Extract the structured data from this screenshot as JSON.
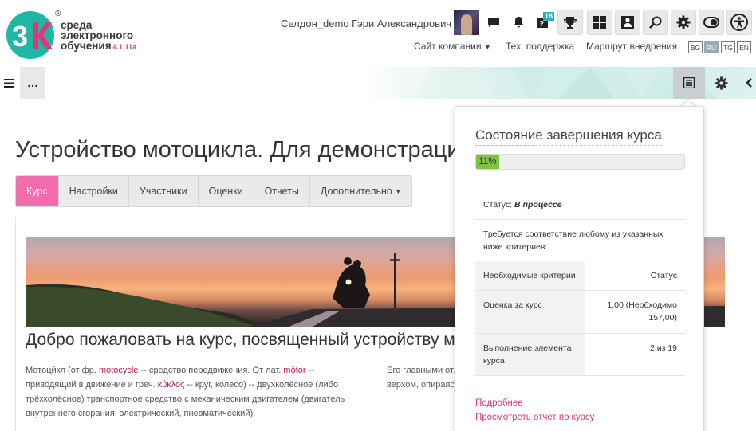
{
  "brand": {
    "line1": "среда",
    "line2": "электронного",
    "line3": "обучения",
    "version": "4.1.11a",
    "reg": "®",
    "colors": {
      "teal": "#1fb7a4",
      "pink": "#e0367a",
      "purple": "#7b3fa0"
    }
  },
  "header": {
    "user_name": "Селдон_demo Гэри Александрович",
    "notification_badge": "18",
    "icons": [
      "chat-icon",
      "bell-icon",
      "message-badge-icon",
      "trophy-icon",
      "dashboard-icon",
      "people-icon",
      "search-icon",
      "gear-icon",
      "toggle-icon",
      "accessibility-icon"
    ],
    "nav": {
      "company_site": "Сайт компании",
      "support": "Тех. поддержка",
      "route": "Маршрут внедрения"
    },
    "languages": [
      {
        "code": "BG",
        "active": false
      },
      {
        "code": "RU",
        "active": true
      },
      {
        "code": "TG",
        "active": false
      },
      {
        "code": "EN",
        "active": false
      }
    ]
  },
  "course": {
    "title": "Устройство мотоцикла. Для демонстрации",
    "tabs": [
      {
        "label": "Курс",
        "active": true
      },
      {
        "label": "Настройки",
        "active": false
      },
      {
        "label": "Участники",
        "active": false
      },
      {
        "label": "Оценки",
        "active": false
      },
      {
        "label": "Отчеты",
        "active": false
      },
      {
        "label": "Дополнительно",
        "active": false
      }
    ],
    "welcome": "Добро пожаловать на курс, посвященный устройству мотоцикла",
    "para1": {
      "p1": "Мотоци́кл (от фр. ",
      "link1": "motocycle",
      "p2": " -- средство передвижения. От лат. ",
      "link2": "mōtor",
      "p3": " -- приводящий в движение и греч. ",
      "link3": "κύκλος",
      "p4": " -- круг, колесо) -- двухколёсное (либо трёхколёсное) транспортное средство с механическим двигателем (двигатель внутреннего сгорания, электрический, пневматический)."
    },
    "para2": "Его главными отличиями являются посадка водителя (мотоциклист сидит верхом, опираясь на подножки), прямое управление передним колесом."
  },
  "completion": {
    "title": "Состояние завершения курса",
    "progress": 11,
    "progress_label": "11%",
    "status_label": "Статус: ",
    "status_value": "В процессе",
    "requirement": "Требуется соответствие любому из указанных ниже критериев:",
    "criteria_header": {
      "col1": "Необходимые критерии",
      "col2": "Статус"
    },
    "criteria": [
      {
        "name": "Оценка за курс",
        "status": "1,00 (Необходимо 157,00)"
      },
      {
        "name": "Выполнение элемента курса",
        "status": "2 из 19"
      }
    ],
    "more_link": "Подробнее",
    "report_link": "Просмотреть отчет по курсу"
  }
}
